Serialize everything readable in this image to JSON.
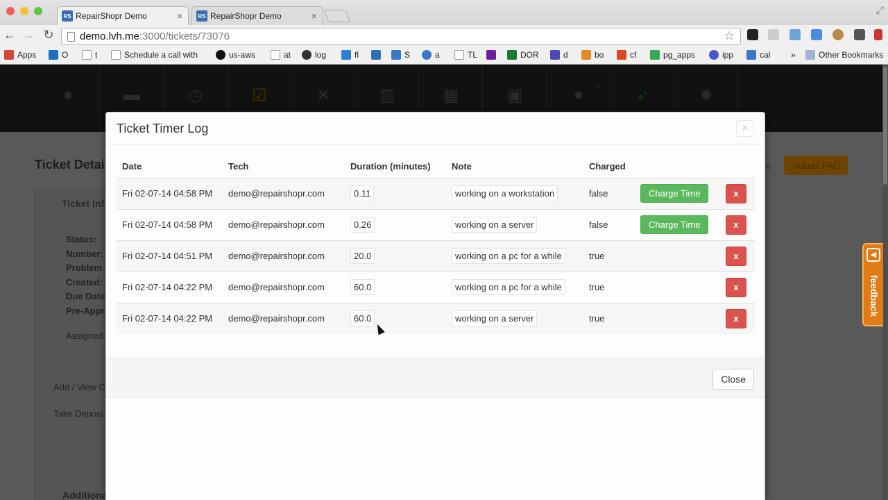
{
  "browser": {
    "tabs": [
      {
        "title": "RepairShopr Demo",
        "favicon": "RS"
      },
      {
        "title": "RepairShopr Demo",
        "favicon": "RS"
      }
    ],
    "url_host": "demo.lvh.me",
    "url_path": ":3000/tickets/73076",
    "bookmarks": [
      {
        "label": "Apps",
        "icon": "apps-grid-icon",
        "color": "#d14836"
      },
      {
        "label": "O",
        "icon": "outlook-icon",
        "color": "#1d6fc2"
      },
      {
        "label": "t",
        "icon": "page-icon",
        "color": "#ffffff"
      },
      {
        "label": "Schedule a call with",
        "icon": "page-icon",
        "color": "#ffffff"
      },
      {
        "label": "us-aws",
        "icon": "amazon-icon",
        "color": "#111111"
      },
      {
        "label": "at",
        "icon": "page-icon",
        "color": "#ffffff"
      },
      {
        "label": "log",
        "icon": "gear-icon",
        "color": "#333333"
      },
      {
        "label": "fl",
        "icon": "image-icon",
        "color": "#2a7fd4"
      },
      {
        "label": "",
        "icon": "trello-icon",
        "color": "#2c6fb4"
      },
      {
        "label": "S",
        "icon": "window-icon",
        "color": "#3b78c9"
      },
      {
        "label": "a",
        "icon": "analytics-icon",
        "color": "#3b78c9"
      },
      {
        "label": "TL",
        "icon": "page-icon",
        "color": "#ffffff"
      },
      {
        "label": "",
        "icon": "yahoo-icon",
        "color": "#6b1f9c"
      },
      {
        "label": "DOR",
        "icon": "dor-icon",
        "color": "#1c7a2e"
      },
      {
        "label": "d",
        "icon": "d-icon",
        "color": "#4a4ab0"
      },
      {
        "label": "bo",
        "icon": "megaphone-icon",
        "color": "#e08a2a"
      },
      {
        "label": "cf",
        "icon": "cf-icon",
        "color": "#d64b1e"
      },
      {
        "label": "pg_apps",
        "icon": "google-icon",
        "color": "#34a853"
      },
      {
        "label": "ipp",
        "icon": "circle-icon",
        "color": "#4a56c9"
      },
      {
        "label": "cal",
        "icon": "calendar-icon",
        "color": "#3b78c9"
      }
    ],
    "overflow": "»",
    "other_bookmarks": "Other Bookmarks"
  },
  "background": {
    "ticket_title": "Ticket Detai",
    "ticket_info": "Ticket Inf",
    "labels": [
      "Status:",
      "Number:",
      "Problem",
      "Created:",
      "Due Date",
      "Pre-Appr",
      "Assigned"
    ],
    "buttons": [
      "Add / View C",
      "Take Deposi"
    ],
    "additional": "Additiona",
    "faq_button": "Tickets FAQ",
    "update_text": "te",
    "badge": "4"
  },
  "modal": {
    "title": "Ticket Timer Log",
    "close_x": "×",
    "columns": [
      "Date",
      "Tech",
      "Duration (minutes)",
      "Note",
      "Charged"
    ],
    "rows": [
      {
        "date": "Fri 02-07-14 04:58 PM",
        "tech": "demo@repairshopr.com",
        "duration": "0.11",
        "note": "working on a workstation",
        "charged": "false",
        "charge_label": "Charge Time",
        "delete_label": "x"
      },
      {
        "date": "Fri 02-07-14 04:58 PM",
        "tech": "demo@repairshopr.com",
        "duration": "0.26",
        "note": "working on a server",
        "charged": "false",
        "charge_label": "Charge Time",
        "delete_label": "x"
      },
      {
        "date": "Fri 02-07-14 04:51 PM",
        "tech": "demo@repairshopr.com",
        "duration": "20.0",
        "note": "working on a pc for a while",
        "charged": "true",
        "charge_label": "",
        "delete_label": "x"
      },
      {
        "date": "Fri 02-07-14 04:22 PM",
        "tech": "demo@repairshopr.com",
        "duration": "60.0",
        "note": "working on a pc for a while",
        "charged": "true",
        "charge_label": "",
        "delete_label": "x"
      },
      {
        "date": "Fri 02-07-14 04:22 PM",
        "tech": "demo@repairshopr.com",
        "duration": "60.0",
        "note": "working on a server",
        "charged": "true",
        "charge_label": "",
        "delete_label": "x"
      }
    ],
    "close_button": "Close"
  },
  "feedback": {
    "label": "feedback"
  }
}
